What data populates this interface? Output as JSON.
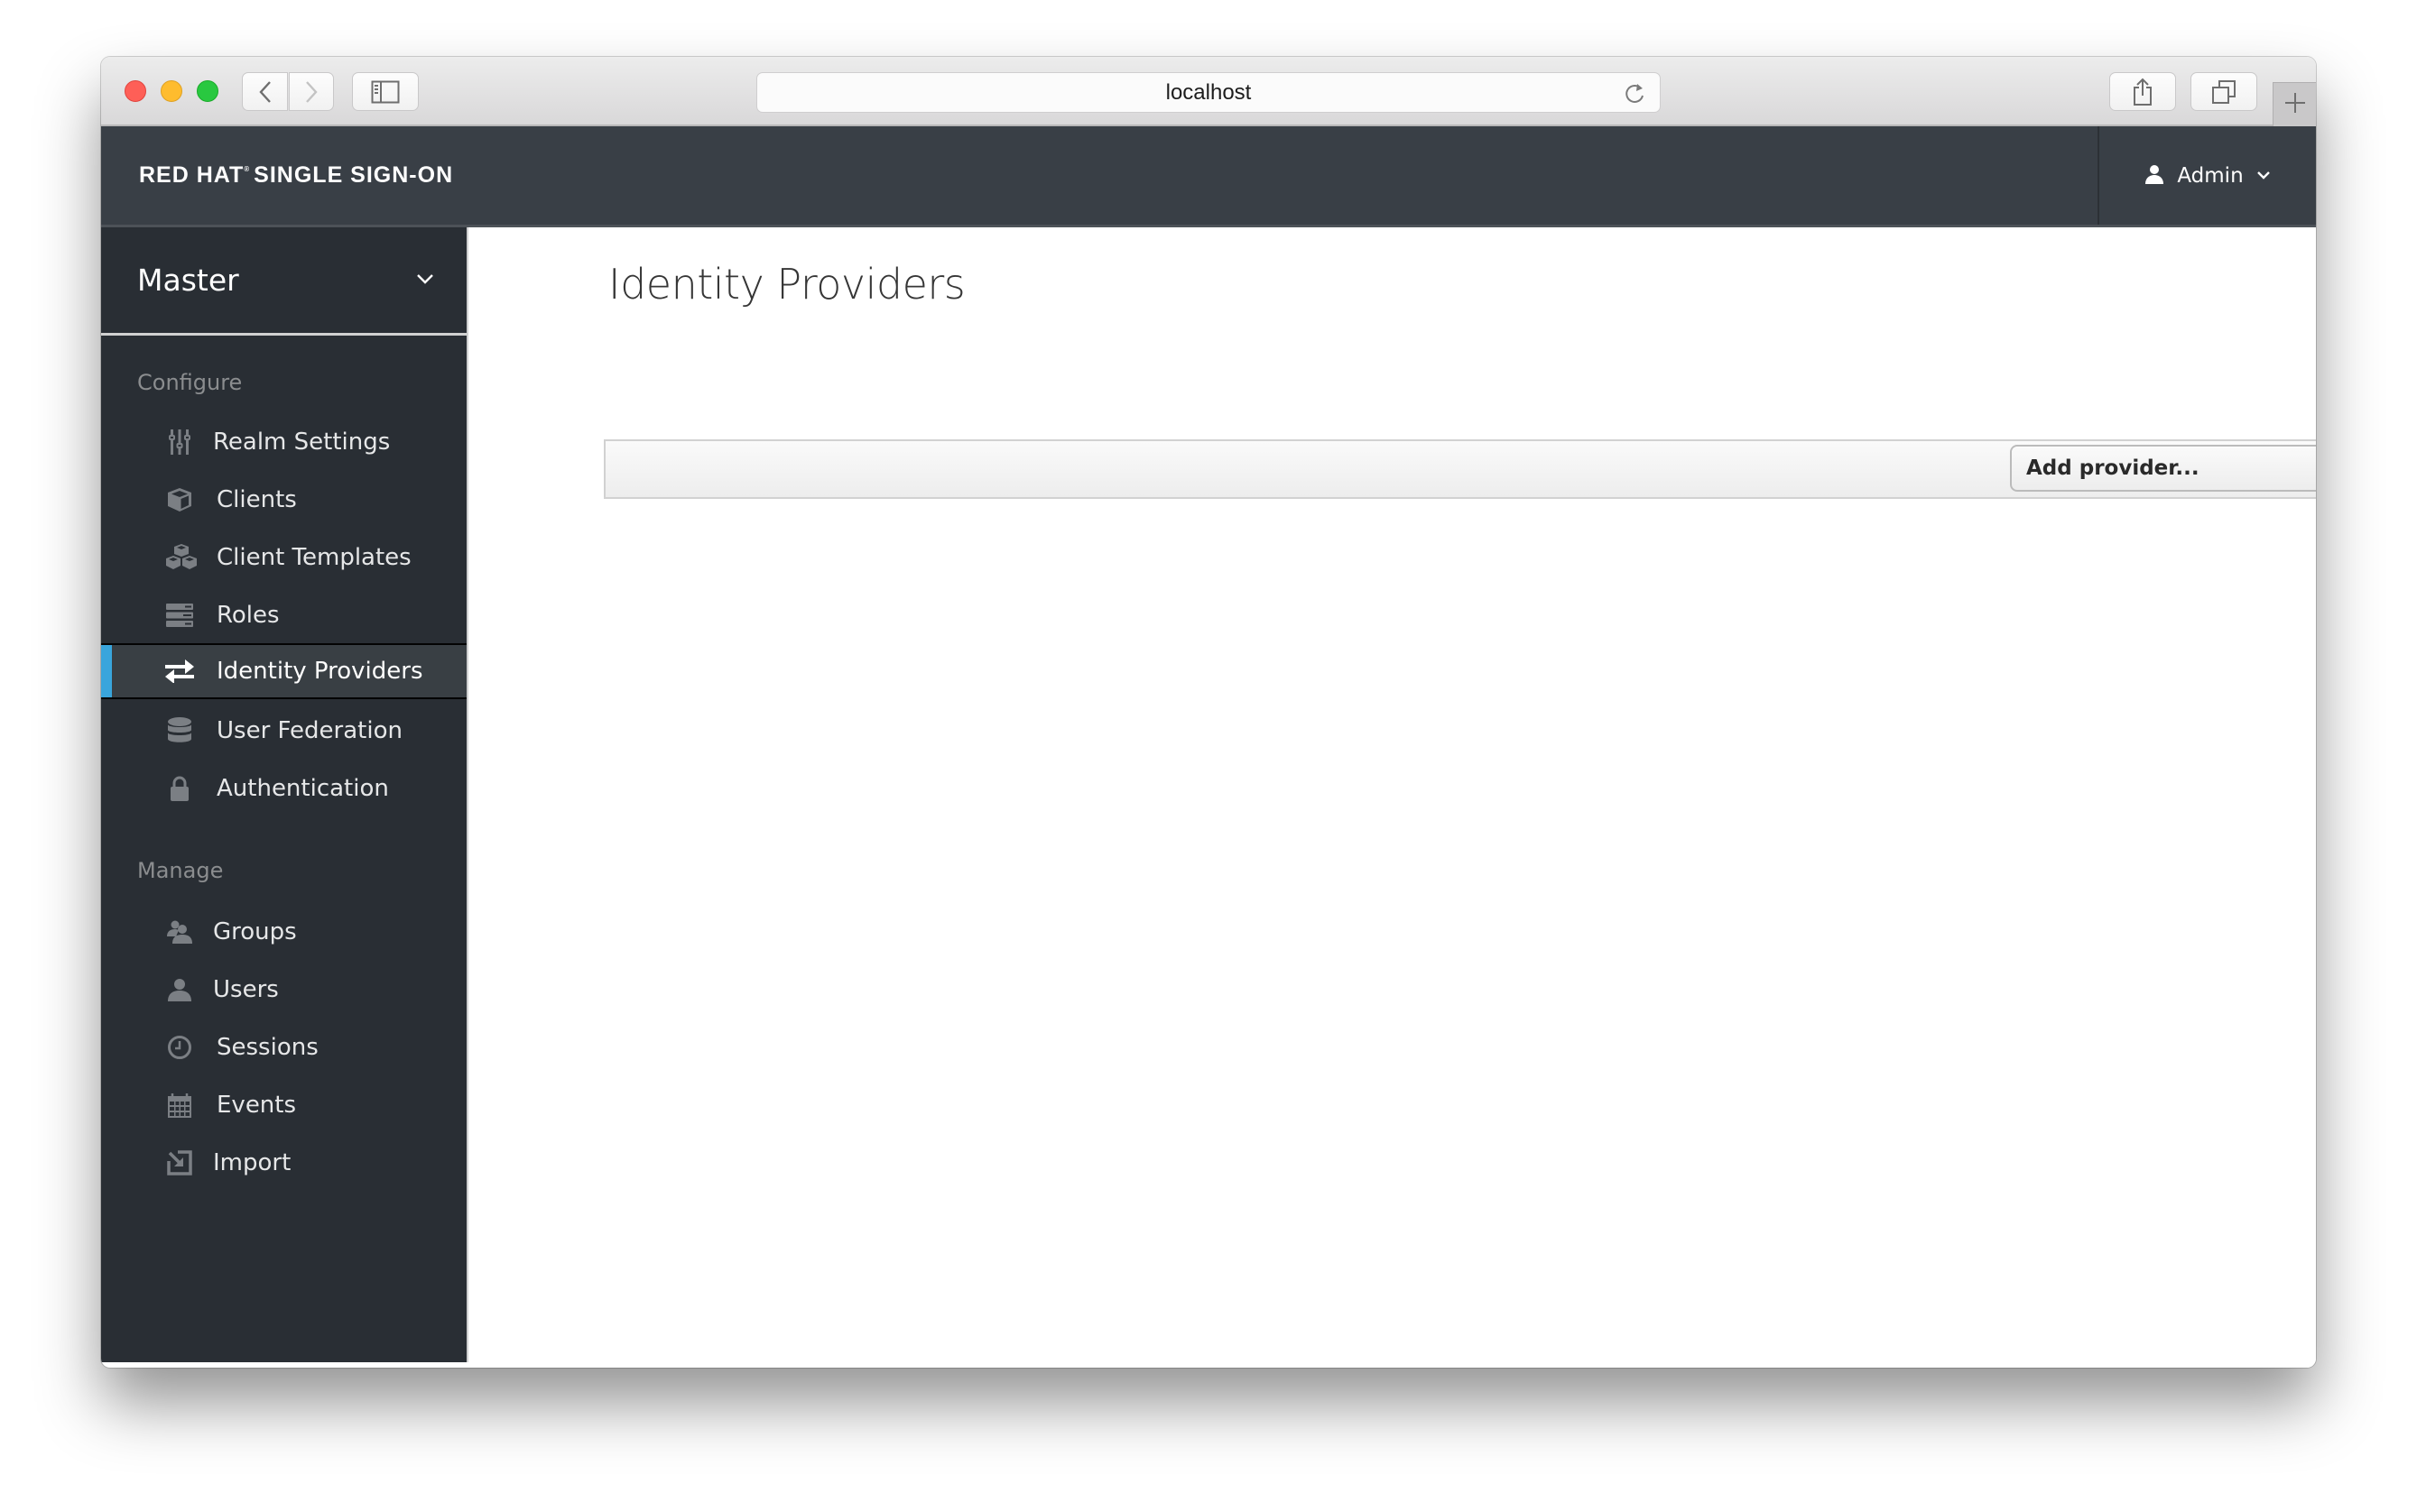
{
  "browser": {
    "url": "localhost",
    "buttons": {
      "back": "back-button",
      "forward": "forward-button",
      "sidebar": "sidebar-toggle-button",
      "share": "share-button",
      "tabs": "tab-overview-button",
      "new_tab": "new-tab-button"
    }
  },
  "header": {
    "brand_main": "RED HAT",
    "brand_mark": "®",
    "brand_sub": "SINGLE SIGN-ON",
    "user_name": "Admin"
  },
  "sidebar": {
    "realm": "Master",
    "sections": [
      {
        "label": "Configure",
        "items": [
          {
            "label": "Realm Settings",
            "icon": "sliders-icon",
            "active": false
          },
          {
            "label": "Clients",
            "icon": "cube-icon",
            "active": false
          },
          {
            "label": "Client Templates",
            "icon": "cubes-icon",
            "active": false
          },
          {
            "label": "Roles",
            "icon": "server-icon",
            "active": false
          },
          {
            "label": "Identity Providers",
            "icon": "exchange-icon",
            "active": true
          },
          {
            "label": "User Federation",
            "icon": "database-icon",
            "active": false
          },
          {
            "label": "Authentication",
            "icon": "lock-icon",
            "active": false
          }
        ]
      },
      {
        "label": "Manage",
        "items": [
          {
            "label": "Groups",
            "icon": "users-icon",
            "active": false
          },
          {
            "label": "Users",
            "icon": "user-icon",
            "active": false
          },
          {
            "label": "Sessions",
            "icon": "clock-icon",
            "active": false
          },
          {
            "label": "Events",
            "icon": "calendar-icon",
            "active": false
          },
          {
            "label": "Import",
            "icon": "import-icon",
            "active": false
          }
        ]
      }
    ]
  },
  "main": {
    "title": "Identity Providers",
    "add_provider": {
      "selected": "Add provider..."
    }
  },
  "colors": {
    "header_bg": "#393f46",
    "sidebar_bg": "#292e34",
    "active_accent": "#39a5dc",
    "active_item_bg": "#393f44"
  }
}
